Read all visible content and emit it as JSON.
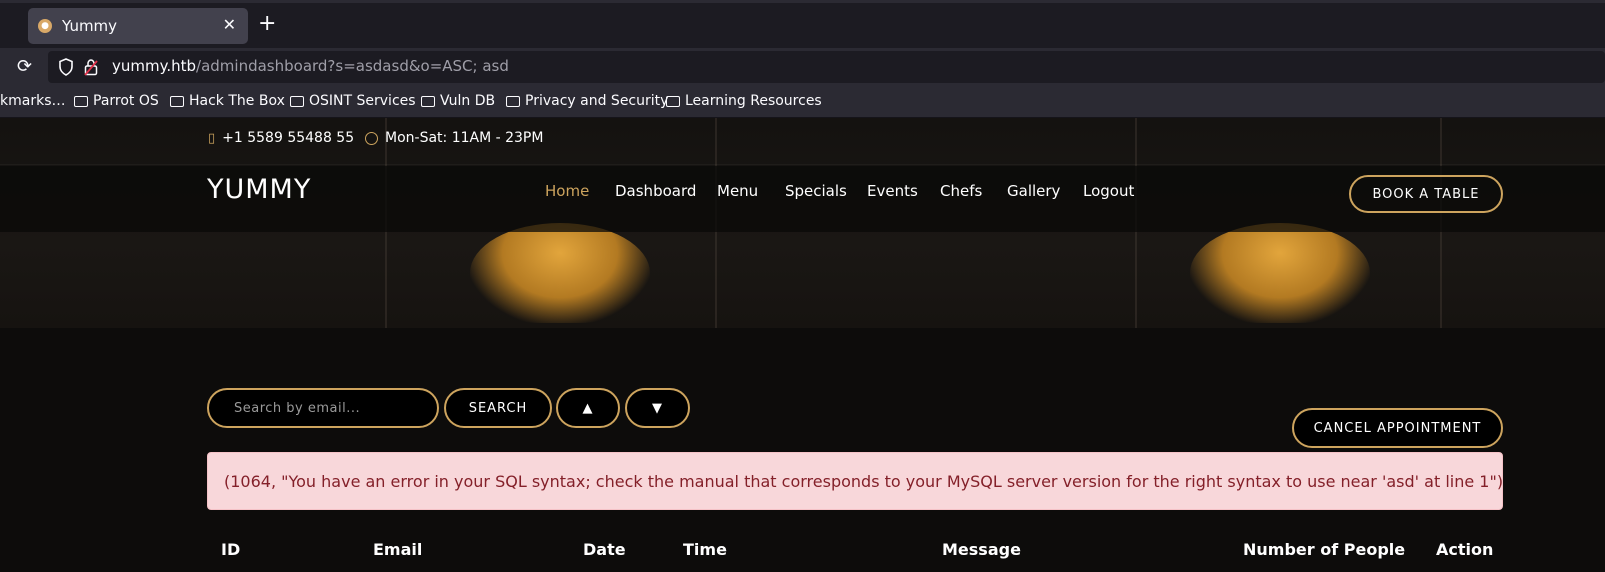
{
  "browser": {
    "tab_title": "Yummy",
    "new_tab": "+",
    "close": "✕",
    "url_host": "yummy.htb",
    "url_path": "/admindashboard?s=asdasd&o=ASC; asd",
    "bookmarks": [
      "kmarks…",
      "Parrot OS",
      "Hack The Box",
      "OSINT Services",
      "Vuln DB",
      "Privacy and Security",
      "Learning Resources"
    ]
  },
  "topbar": {
    "phone": "+1 5589 55488 55",
    "hours": "Mon-Sat: 11AM - 23PM"
  },
  "header": {
    "logo": "YUMMY",
    "nav": [
      "Home",
      "Dashboard",
      "Menu",
      "Specials",
      "Events",
      "Chefs",
      "Gallery",
      "Logout"
    ],
    "active": "Home",
    "book_button": "BOOK A TABLE"
  },
  "controls": {
    "search_placeholder": "Search by email...",
    "search_button": "SEARCH",
    "sort_asc": "▲",
    "sort_desc": "▼",
    "cancel_button": "CANCEL APPOINTMENT"
  },
  "error": {
    "message": "(1064, \"You have an error in your SQL syntax; check the manual that corresponds to your MySQL server version for the right syntax to use near 'asd' at line 1\")"
  },
  "table": {
    "headers": [
      "ID",
      "Email",
      "Date",
      "Time",
      "Message",
      "Number of People",
      "Action"
    ]
  },
  "colors": {
    "accent": "#cda45e",
    "alert_bg": "#f8d7da",
    "alert_text": "#842029"
  }
}
